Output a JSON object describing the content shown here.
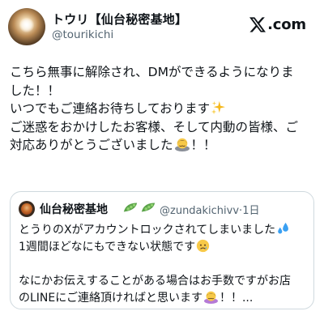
{
  "author": {
    "display_name": "トウリ【仙台秘密基地】",
    "handle": "@tourikichi"
  },
  "brand": {
    "text": ".com",
    "icon": "x-logo-icon"
  },
  "tweet": {
    "lines": [
      "こちら無事に解除され、DMができるようになりま",
      "した！！",
      "いつでもご連絡お待ちしております",
      "ご迷惑をおかけしたお客様、そして内動の皆様、ご",
      "対応ありがとうございました",
      "！！"
    ],
    "emojis": [
      "sparkles-icon",
      "bowing-person-icon"
    ]
  },
  "quote": {
    "display_name": "仙台秘密基地",
    "name_emojis": [
      "pea-pod-icon",
      "pea-pod-icon"
    ],
    "handle": "@zundakichivv",
    "separator": "·",
    "time": "1日",
    "lines": [
      "とうりのXがアカウントロックされてしまいました",
      "1週間ほどなにもできない状態です",
      "",
      "なにかお伝えすることがある場合はお手数ですがお店",
      "のLINEにご連絡頂ければと思います",
      "！！..."
    ],
    "emojis": [
      "sweat-droplets-icon",
      "worried-face-icon",
      "bowing-person-icon"
    ]
  }
}
